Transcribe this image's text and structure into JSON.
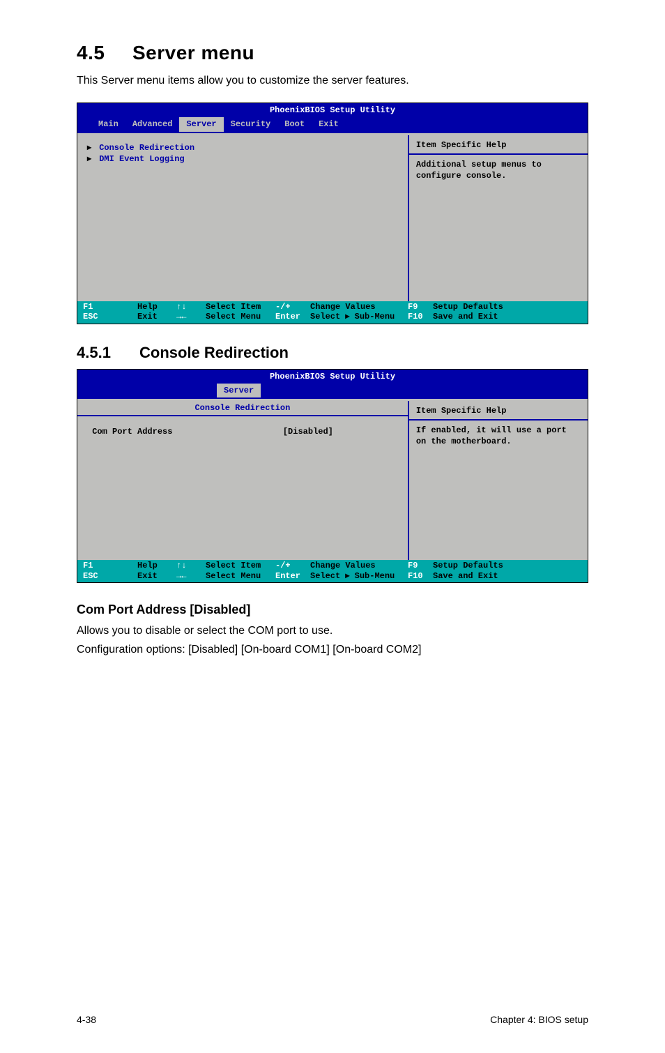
{
  "sec45": {
    "num": "4.5",
    "title": "Server menu"
  },
  "intro45": "This Server menu items allow you to customize the server features.",
  "bios_common": {
    "title": "PhoenixBIOS Setup Utility",
    "tabs": {
      "main": "Main",
      "advanced": "Advanced",
      "server": "Server",
      "security": "Security",
      "boot": "Boot",
      "exit": "Exit"
    },
    "help_title": "Item Specific Help",
    "footer": {
      "f1": "F1",
      "esc": "ESC",
      "help": "Help",
      "exit": "Exit",
      "updown": "↑↓",
      "leftright": "→←",
      "select_item": "Select Item",
      "select_menu": "Select Menu",
      "minusplus": "-/+",
      "enter": "Enter",
      "change_values": "Change Values",
      "select_sub": "Select ▸ Sub-Menu",
      "f9": "F9",
      "f10": "F10",
      "setup_defaults": "Setup Defaults",
      "save_exit": "Save and Exit"
    }
  },
  "bios1": {
    "items": [
      "Console Redirection",
      "DMI Event Logging"
    ],
    "help_text": "Additional setup menus to configure console."
  },
  "sec451": {
    "num": "4.5.1",
    "title": "Console Redirection"
  },
  "bios2": {
    "screen_header": "Console Redirection",
    "field_label": "Com Port Address",
    "field_value": "[Disabled]",
    "help_text": "If enabled, it will use a port on the motherboard."
  },
  "param": {
    "title": "Com Port Address [Disabled]",
    "line1": "Allows you to disable or select the COM port to use.",
    "line2": "Configuration options: [Disabled] [On-board COM1] [On-board COM2]"
  },
  "footer": {
    "left": "4-38",
    "right": "Chapter 4: BIOS setup"
  }
}
